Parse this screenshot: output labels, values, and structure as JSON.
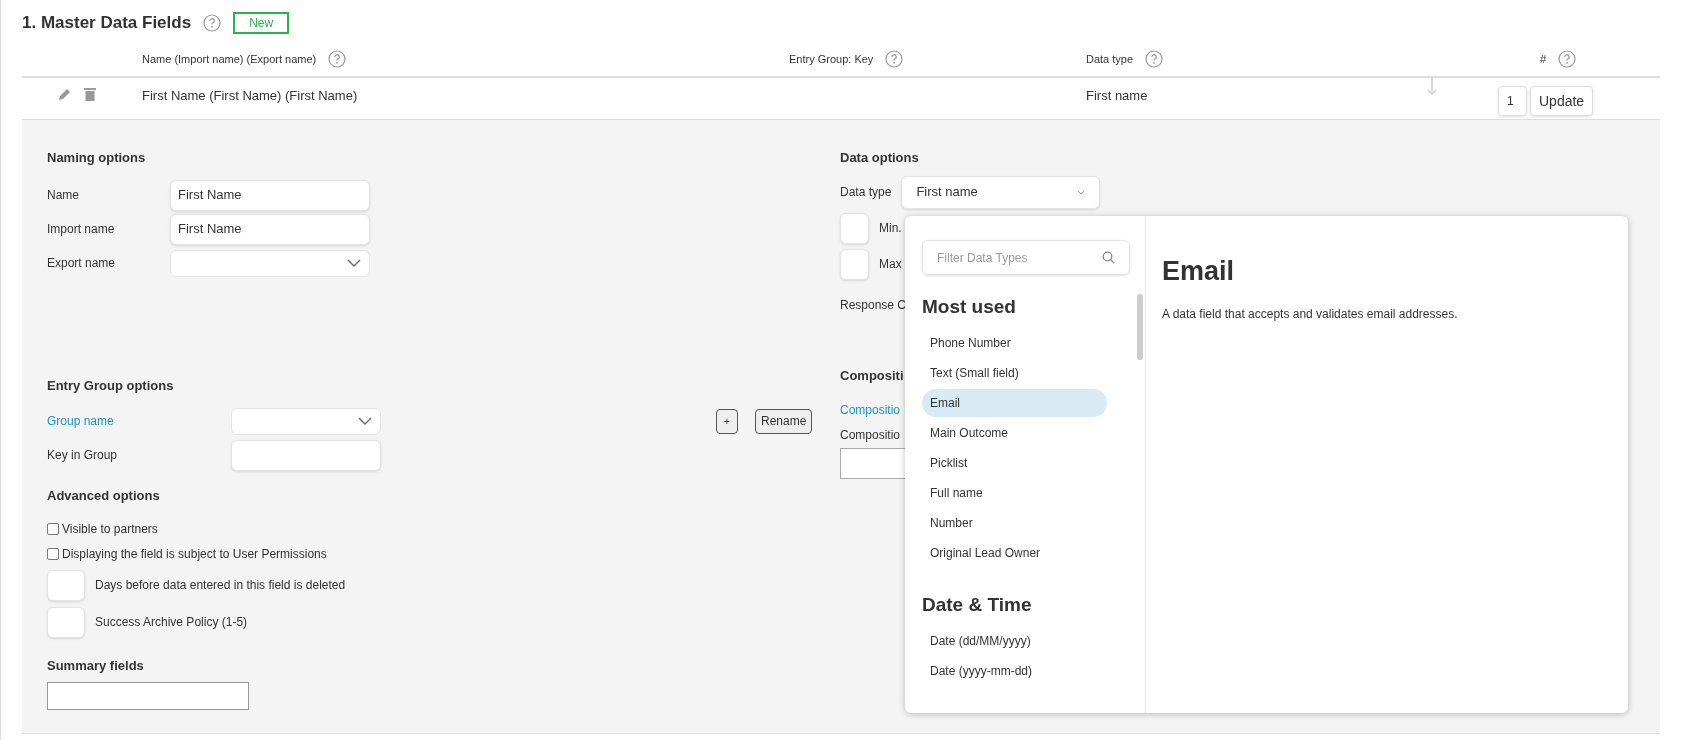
{
  "section": {
    "title": "1. Master Data Fields",
    "new_button": "New"
  },
  "table": {
    "columns": [
      {
        "label": "Name (Import name) (Export name)"
      },
      {
        "label": "Entry Group: Key"
      },
      {
        "label": "Data type"
      },
      {
        "label": "#"
      }
    ],
    "row": {
      "name": "First Name (First Name) (First Name)",
      "data_type": "First name",
      "order": "1",
      "update_button": "Update"
    }
  },
  "naming_options": {
    "title": "Naming options",
    "fields": [
      {
        "kind": "input",
        "label": "Name",
        "value": "First Name"
      },
      {
        "kind": "input",
        "label": "Import name",
        "value": "First Name"
      },
      {
        "kind": "select",
        "label": "Export name"
      }
    ]
  },
  "entry_group_options": {
    "title": "Entry Group options",
    "group_name_link": "Group name",
    "key_label": "Key in Group",
    "add_button": "+",
    "rename_button": "Rename"
  },
  "advanced_options": {
    "title": "Advanced options",
    "checkboxes": [
      {
        "label": "Visible to partners",
        "checked": false
      },
      {
        "label": "Displaying the field is subject to User Permissions",
        "checked": false
      }
    ],
    "number_fields": [
      {
        "label": "Days before data entered in this field is deleted"
      },
      {
        "label": "Success Archive Policy (1-5)"
      }
    ]
  },
  "summary_fields": {
    "title": "Summary fields"
  },
  "data_options": {
    "title": "Data options",
    "data_type_label": "Data type",
    "data_type_value": "First name",
    "min_label": "Min.",
    "max_label": "Max",
    "response_label": "Response C"
  },
  "composition": {
    "title": "Compositi",
    "link": "Compositio",
    "label": "Compositio"
  },
  "data_type_popover": {
    "filter_placeholder": "Filter Data Types",
    "groups": [
      {
        "title": "Most used",
        "items": [
          {
            "label": "Phone Number",
            "selected": false
          },
          {
            "label": "Text (Small field)",
            "selected": false
          },
          {
            "label": "Email",
            "selected": true
          },
          {
            "label": "Main Outcome",
            "selected": false
          },
          {
            "label": "Picklist",
            "selected": false
          },
          {
            "label": "Full name",
            "selected": false
          },
          {
            "label": "Number",
            "selected": false
          },
          {
            "label": "Original Lead Owner",
            "selected": false
          }
        ]
      },
      {
        "title": "Date & Time",
        "items": [
          {
            "label": "Date (dd/MM/yyyy)",
            "selected": false
          },
          {
            "label": "Date (yyyy-mm-dd)",
            "selected": false
          }
        ]
      }
    ],
    "detail_title": "Email",
    "detail_text": "A data field that accepts and validates email addresses."
  }
}
